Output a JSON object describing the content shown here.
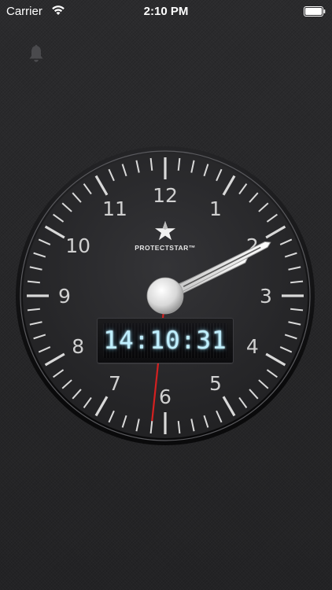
{
  "status_bar": {
    "carrier": "Carrier",
    "time": "2:10 PM"
  },
  "clock": {
    "brand": "PROTECTSTAR™",
    "numerals": [
      "12",
      "1",
      "2",
      "3",
      "4",
      "5",
      "6",
      "7",
      "8",
      "9",
      "10",
      "11"
    ],
    "digital_time": "14:10:31",
    "hour": 14,
    "minute": 10,
    "second": 31,
    "colors": {
      "face": "#29292c",
      "ticks": "#d9d9d9",
      "numerals": "#d0d0d0",
      "second_hand": "#d42020",
      "digital_glow": "#bfefff"
    }
  },
  "icons": {
    "bell": "bell-icon",
    "wifi": "wifi-icon",
    "battery": "battery-icon",
    "logo": "star-logo-icon"
  }
}
